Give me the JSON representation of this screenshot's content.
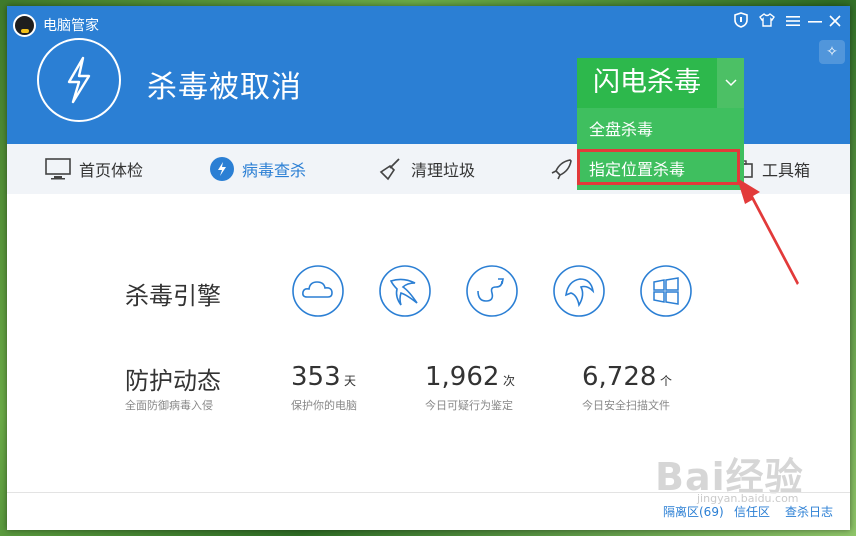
{
  "app": {
    "title": "电脑管家"
  },
  "header": {
    "status": "杀毒被取消",
    "quick_scan_button": "闪电杀毒",
    "expand_icon": "chevron-down-icon"
  },
  "dropdown": {
    "items": [
      "全盘杀毒",
      "指定位置杀毒"
    ]
  },
  "nav": {
    "items": [
      {
        "label": "首页体检",
        "icon": "monitor-icon"
      },
      {
        "label": "病毒查杀",
        "icon": "bolt-icon"
      },
      {
        "label": "清理垃圾",
        "icon": "broom-icon"
      },
      {
        "label": "",
        "icon": "rocket-icon"
      },
      {
        "label": "工具箱",
        "icon": "toolbox-icon"
      }
    ],
    "active_index": 1
  },
  "engines": {
    "label": "杀毒引擎",
    "icons": [
      "cloud-engine-icon",
      "eagle-engine-icon",
      "swirl-engine-icon",
      "shield-engine-icon",
      "windows-engine-icon"
    ]
  },
  "protection": {
    "label": "防护动态",
    "sublabel": "全面防御病毒入侵",
    "stats": [
      {
        "value": "353",
        "unit": "天",
        "label": "保护你的电脑"
      },
      {
        "value": "1,962",
        "unit": "次",
        "label": "今日可疑行为鉴定"
      },
      {
        "value": "6,728",
        "unit": "个",
        "label": "今日安全扫描文件"
      }
    ]
  },
  "footer": {
    "links": [
      "隔离区(69)",
      "信任区",
      "查杀日志"
    ]
  },
  "watermark": {
    "text": "Bai经验",
    "sub": "jingyan.baidu.com"
  },
  "colors": {
    "header_blue": "#2b7fd4",
    "flash_green": "#2db84c",
    "highlight_red": "#e23a3a"
  }
}
